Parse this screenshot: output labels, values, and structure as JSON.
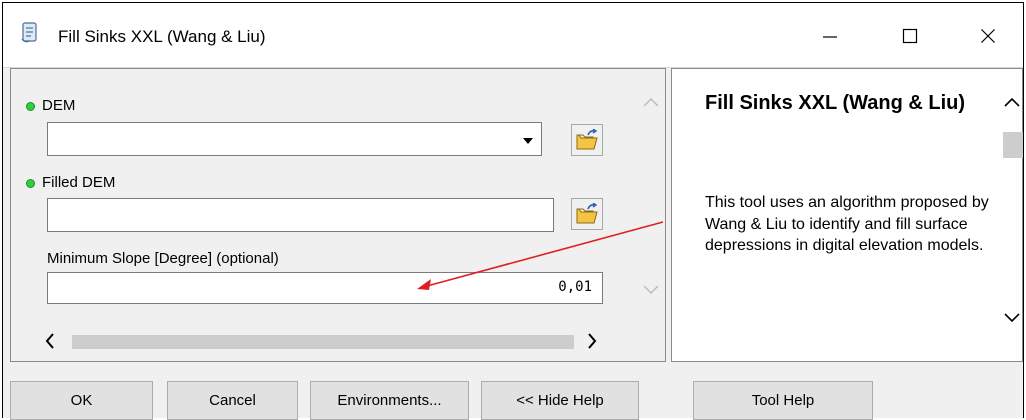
{
  "window": {
    "title": "Fill Sinks XXL (Wang & Liu)",
    "minimize_glyph": "—",
    "maximize_glyph": "☐",
    "close_glyph": "✕",
    "icon": "script-tool-icon"
  },
  "parameters": {
    "dem": {
      "label": "DEM",
      "value": "",
      "required": true
    },
    "filled_dem": {
      "label": "Filled DEM",
      "value": "",
      "required": true
    },
    "min_slope": {
      "label": "Minimum Slope [Degree] (optional)",
      "value": "0,01"
    }
  },
  "help": {
    "title": "Fill Sinks XXL (Wang & Liu)",
    "body": "This tool uses an algorithm proposed by Wang & Liu to identify and fill surface depressions in digital elevation models."
  },
  "buttons": {
    "ok": "OK",
    "cancel": "Cancel",
    "environments": "Environments...",
    "hide_help": "<< Hide Help",
    "tool_help": "Tool Help"
  },
  "colors": {
    "required_bullet": "#2fcf3f",
    "annotation_arrow": "#e02020",
    "folder_icon": "#f5c542"
  }
}
